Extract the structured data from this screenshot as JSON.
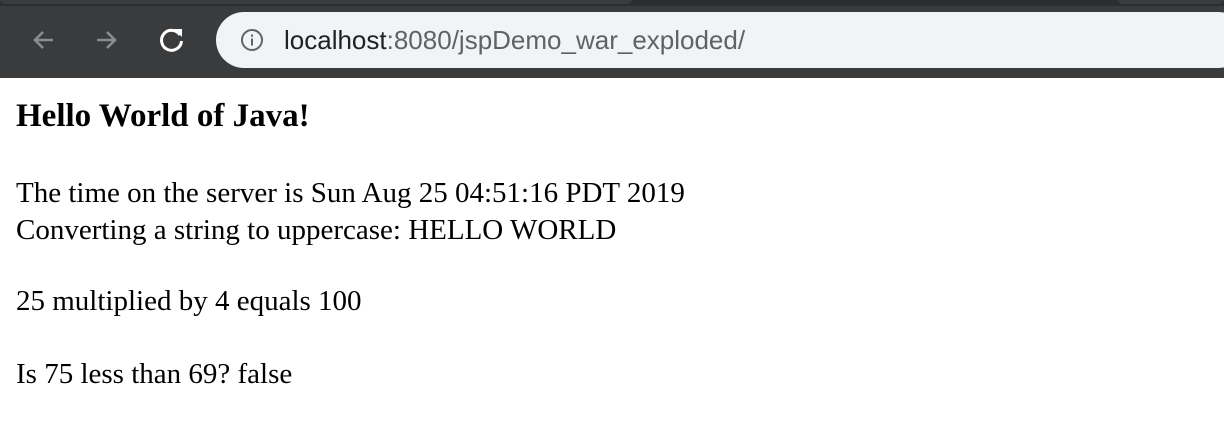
{
  "browser": {
    "address_host": "localhost",
    "address_rest": ":8080/jspDemo_war_exploded/",
    "icons": {
      "back": "back-arrow-icon",
      "forward": "forward-arrow-icon",
      "reload": "reload-icon",
      "site_info": "info-icon"
    },
    "colors": {
      "toolbar": "#3a3b3c",
      "omnibox": "#f1f3f4"
    }
  },
  "page": {
    "heading": "Hello World of Java!",
    "time_line": "The time on the server is Sun Aug 25 04:51:16 PDT 2019",
    "uppercase_line": "Converting a string to uppercase: HELLO WORLD",
    "multiply_line": "25 multiplied by 4 equals 100",
    "compare_line": "Is 75 less than 69? false"
  }
}
